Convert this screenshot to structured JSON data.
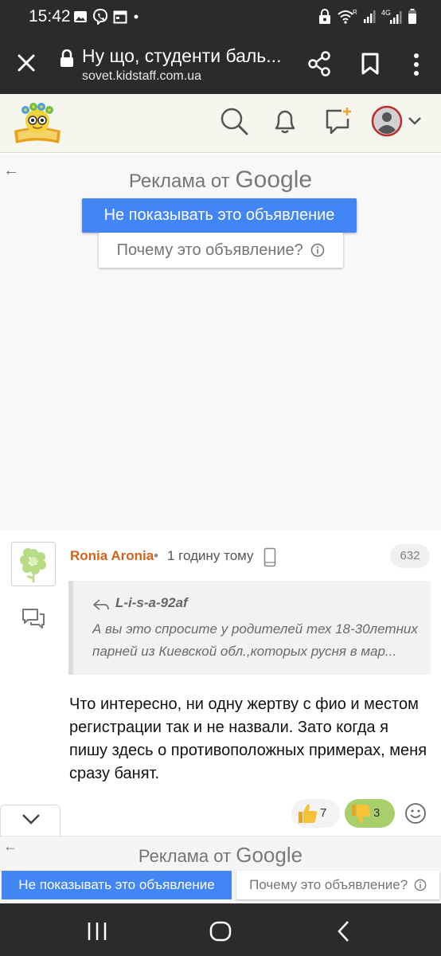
{
  "status_bar": {
    "time": "15:42",
    "icons": [
      "image-icon",
      "viber-icon",
      "calendar-icon",
      "dot-icon",
      "lock-alarm-icon",
      "wifi-icon",
      "signal-icon",
      "battery-icon"
    ],
    "network_labels": [
      "R",
      "4G"
    ]
  },
  "browser": {
    "page_title": "Ну що, студенти баль...",
    "url": "sovet.kidstaff.com.ua"
  },
  "ad_top": {
    "label_prefix": "Реклама от",
    "label_brand": "Google",
    "hide_button": "Не показывать это объявление",
    "why_button": "Почему это объявление?"
  },
  "post": {
    "author": "Ronia Aronia",
    "separator": "•",
    "time": "1 годину тому",
    "number": "632",
    "quote_author": "L-i-s-a-92af",
    "quote_text": "А вы это спросите у родителей тех 18-30летних парней из Киевской обл.,которых русня в мар...",
    "body": "Что интересно, ни одну жертву с фио и местом регистрации так и не назвали. Зато когда я пишу здесь о противоположных примерах, меня сразу банят.",
    "likes": "7",
    "dislikes": "3"
  },
  "ad_bottom": {
    "label_prefix": "Реклама от",
    "label_brand": "Google",
    "hide_button": "Не показывать это объявление",
    "why_button": "Почему это объявление?"
  },
  "colors": {
    "system_bar": "#2b2b2b",
    "header_bg": "#f7f6ee",
    "ad_blue": "#4285f4",
    "author_orange": "#d3621a",
    "dislike_green": "#a9cf6c",
    "notify_orange": "#f0a030"
  }
}
